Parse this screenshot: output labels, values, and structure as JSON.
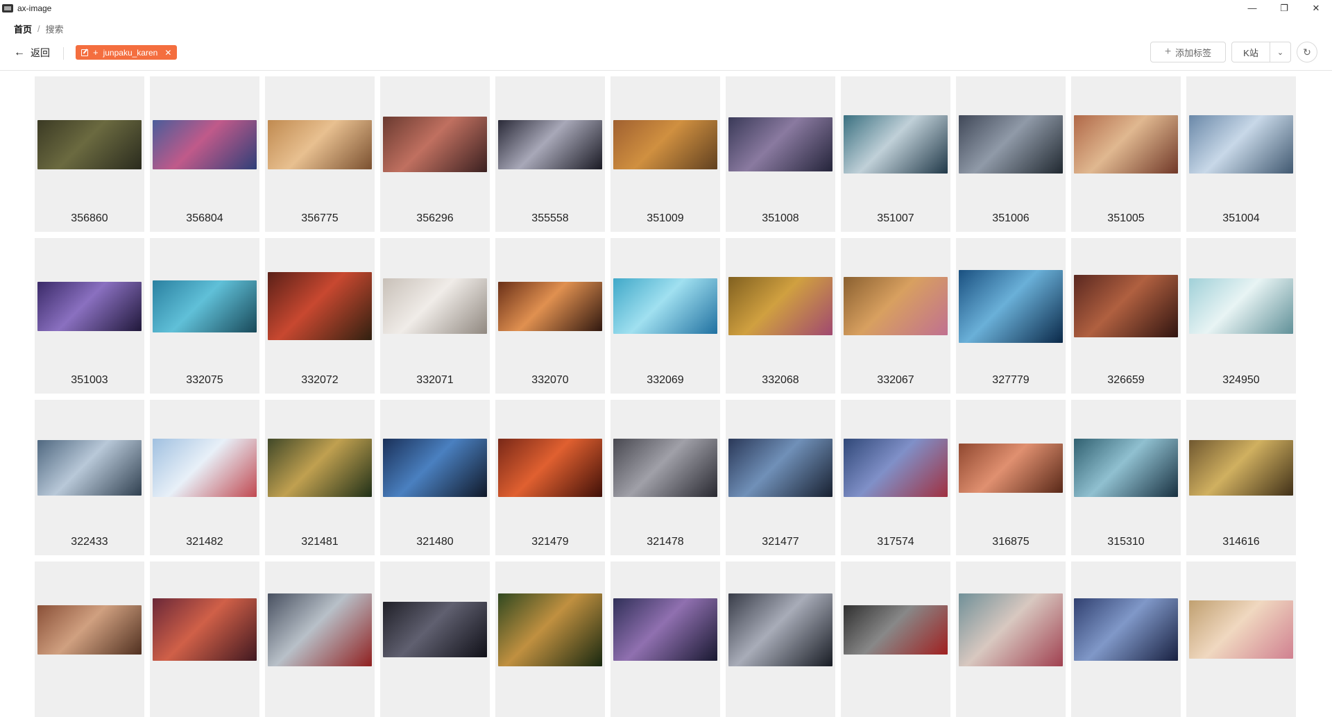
{
  "window": {
    "title": "ax-image"
  },
  "breadcrumb": {
    "home": "首页",
    "separator": "/",
    "current": "搜索"
  },
  "toolbar": {
    "back_label": "返回",
    "tag": {
      "plus": "+",
      "label": "junpaku_karen"
    },
    "add_tag_label": "添加标签",
    "site_label": "K站"
  },
  "icons": {
    "back": "arrow-left-icon",
    "edit": "edit-icon",
    "close": "close-icon",
    "add": "plus-icon",
    "chevron": "chevron-down-icon",
    "refresh": "refresh-icon"
  },
  "colors": {
    "accent": "#f46e3f",
    "card_bg": "#efefef"
  },
  "images": [
    {
      "id": "356860",
      "colors": [
        "#3b3a24",
        "#6b6a40",
        "#2a2b1e"
      ]
    },
    {
      "id": "356804",
      "colors": [
        "#4a5d9a",
        "#c05a8a",
        "#2e3f78"
      ]
    },
    {
      "id": "356775",
      "colors": [
        "#c08a50",
        "#e8c090",
        "#7a5030"
      ]
    },
    {
      "id": "356296",
      "colors": [
        "#6a3a30",
        "#c07060",
        "#3a2020"
      ]
    },
    {
      "id": "355558",
      "colors": [
        "#2a2a38",
        "#a8a8b8",
        "#1a1a24"
      ]
    },
    {
      "id": "351009",
      "colors": [
        "#a06030",
        "#d09040",
        "#604020"
      ]
    },
    {
      "id": "351008",
      "colors": [
        "#3a3a58",
        "#8a7aa0",
        "#24243a"
      ]
    },
    {
      "id": "351007",
      "colors": [
        "#3a7080",
        "#c0d0d8",
        "#203848"
      ]
    },
    {
      "id": "351006",
      "colors": [
        "#404858",
        "#909aa8",
        "#202830"
      ]
    },
    {
      "id": "351005",
      "colors": [
        "#b06848",
        "#e0b890",
        "#703828"
      ]
    },
    {
      "id": "351004",
      "colors": [
        "#6a88a8",
        "#c8d8e8",
        "#405870"
      ]
    },
    {
      "id": "351003",
      "colors": [
        "#3a2a68",
        "#8a70c0",
        "#20183a"
      ]
    },
    {
      "id": "332075",
      "colors": [
        "#2a80a0",
        "#60c0d8",
        "#184858"
      ]
    },
    {
      "id": "332072",
      "colors": [
        "#5a2018",
        "#c84830",
        "#302010"
      ]
    },
    {
      "id": "332071",
      "colors": [
        "#c8c0b8",
        "#f0ece8",
        "#908880"
      ]
    },
    {
      "id": "332070",
      "colors": [
        "#6a3018",
        "#e09050",
        "#301810"
      ]
    },
    {
      "id": "332069",
      "colors": [
        "#40a8c8",
        "#a0e0f0",
        "#2070a0"
      ]
    },
    {
      "id": "332068",
      "colors": [
        "#806020",
        "#d0a040",
        "#a04870"
      ]
    },
    {
      "id": "332067",
      "colors": [
        "#8a6030",
        "#d8a060",
        "#c07090"
      ]
    },
    {
      "id": "327779",
      "colors": [
        "#1a5080",
        "#6ab0d8",
        "#0a2848"
      ]
    },
    {
      "id": "326659",
      "colors": [
        "#5a2820",
        "#b06040",
        "#301410"
      ]
    },
    {
      "id": "324950",
      "colors": [
        "#a0d0d8",
        "#e8f4f4",
        "#609098"
      ]
    },
    {
      "id": "322433",
      "colors": [
        "#506880",
        "#b8c8d8",
        "#304050"
      ]
    },
    {
      "id": "321482",
      "colors": [
        "#a0c0e0",
        "#e8f0f8",
        "#c04850"
      ]
    },
    {
      "id": "321481",
      "colors": [
        "#404828",
        "#c0a050",
        "#203018"
      ]
    },
    {
      "id": "321480",
      "colors": [
        "#1a3058",
        "#4a80c0",
        "#101828"
      ]
    },
    {
      "id": "321479",
      "colors": [
        "#782818",
        "#e06030",
        "#401008"
      ]
    },
    {
      "id": "321478",
      "colors": [
        "#484850",
        "#a0a0a8",
        "#282830"
      ]
    },
    {
      "id": "321477",
      "colors": [
        "#2a3858",
        "#7090b8",
        "#182030"
      ]
    },
    {
      "id": "317574",
      "colors": [
        "#304878",
        "#8090c8",
        "#a03040"
      ]
    },
    {
      "id": "316875",
      "colors": [
        "#904830",
        "#e09070",
        "#582818"
      ]
    },
    {
      "id": "315310",
      "colors": [
        "#306070",
        "#90c0d0",
        "#183040"
      ]
    },
    {
      "id": "314616",
      "colors": [
        "#705830",
        "#d0b060",
        "#403018"
      ]
    },
    {
      "id": "",
      "colors": [
        "#8a5038",
        "#d0a080",
        "#503020"
      ]
    },
    {
      "id": "",
      "colors": [
        "#6a2838",
        "#d06048",
        "#401820"
      ]
    },
    {
      "id": "",
      "colors": [
        "#485060",
        "#b8c0c8",
        "#902020"
      ]
    },
    {
      "id": "",
      "colors": [
        "#202028",
        "#606070",
        "#101018"
      ]
    },
    {
      "id": "",
      "colors": [
        "#304820",
        "#c09040",
        "#182810"
      ]
    },
    {
      "id": "",
      "colors": [
        "#303058",
        "#9070b0",
        "#181830"
      ]
    },
    {
      "id": "",
      "colors": [
        "#383c48",
        "#a8acb8",
        "#181c24"
      ]
    },
    {
      "id": "",
      "colors": [
        "#303030",
        "#888888",
        "#a02020"
      ]
    },
    {
      "id": "",
      "colors": [
        "#709098",
        "#d8c8c0",
        "#a04050"
      ]
    },
    {
      "id": "",
      "colors": [
        "#304070",
        "#8098c8",
        "#182040"
      ]
    },
    {
      "id": "",
      "colors": [
        "#c0a070",
        "#f0d8c0",
        "#d08090"
      ]
    }
  ]
}
